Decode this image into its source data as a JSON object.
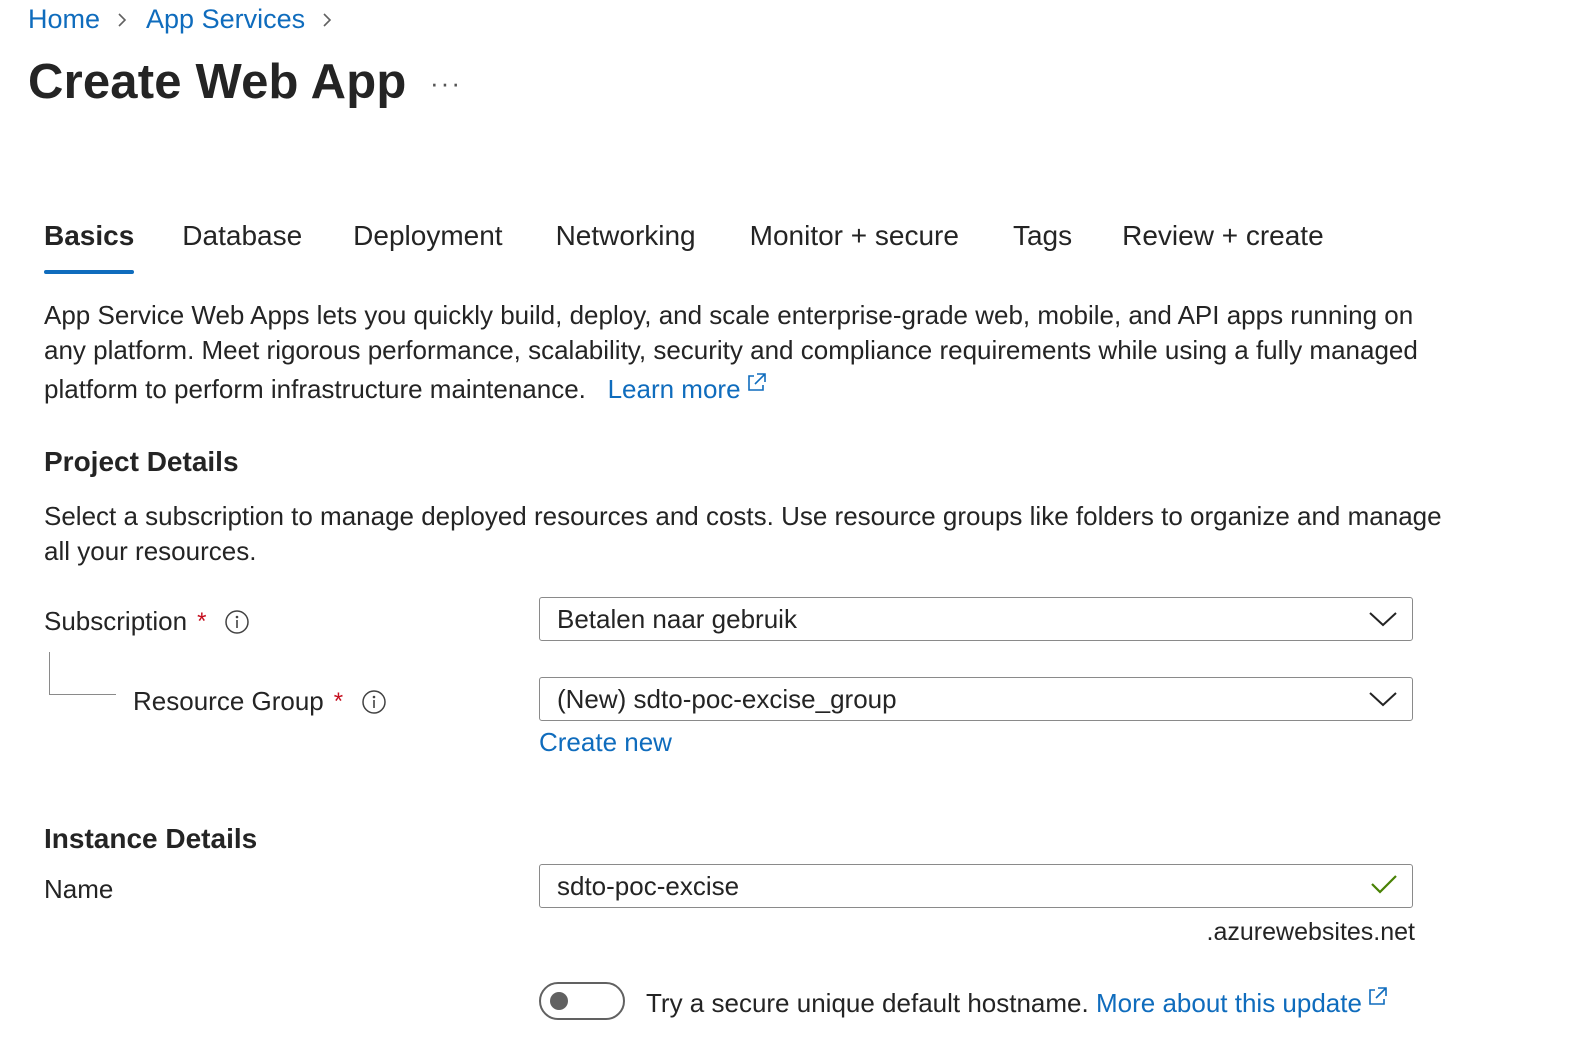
{
  "breadcrumb": [
    {
      "label": "Home"
    },
    {
      "label": "App Services"
    }
  ],
  "page": {
    "title": "Create Web App",
    "more_label": "···"
  },
  "tabs": [
    {
      "label": "Basics",
      "active": true
    },
    {
      "label": "Database"
    },
    {
      "label": "Deployment"
    },
    {
      "label": "Networking"
    },
    {
      "label": "Monitor + secure"
    },
    {
      "label": "Tags"
    },
    {
      "label": "Review + create"
    }
  ],
  "intro": {
    "text": "App Service Web Apps lets you quickly build, deploy, and scale enterprise-grade web, mobile, and API apps running on any platform. Meet rigorous performance, scalability, security and compliance requirements while using a fully managed platform to perform infrastructure maintenance.",
    "learn_more": "Learn more"
  },
  "project_details": {
    "title": "Project Details",
    "description": "Select a subscription to manage deployed resources and costs. Use resource groups like folders to organize and manage all your resources.",
    "subscription": {
      "label": "Subscription",
      "required_mark": "*",
      "value": "Betalen naar gebruik"
    },
    "resource_group": {
      "label": "Resource Group",
      "required_mark": "*",
      "value": "(New) sdto-poc-excise_group",
      "create_new": "Create new"
    }
  },
  "instance_details": {
    "title": "Instance Details",
    "name": {
      "label": "Name",
      "value": "sdto-poc-excise",
      "suffix": ".azurewebsites.net"
    },
    "secure_hostname": {
      "enabled": false,
      "label": "Try a secure unique default hostname.",
      "link": "More about this update"
    }
  },
  "colors": {
    "accent": "#0f6cbd",
    "required": "#c50f1f",
    "valid": "#498205"
  }
}
